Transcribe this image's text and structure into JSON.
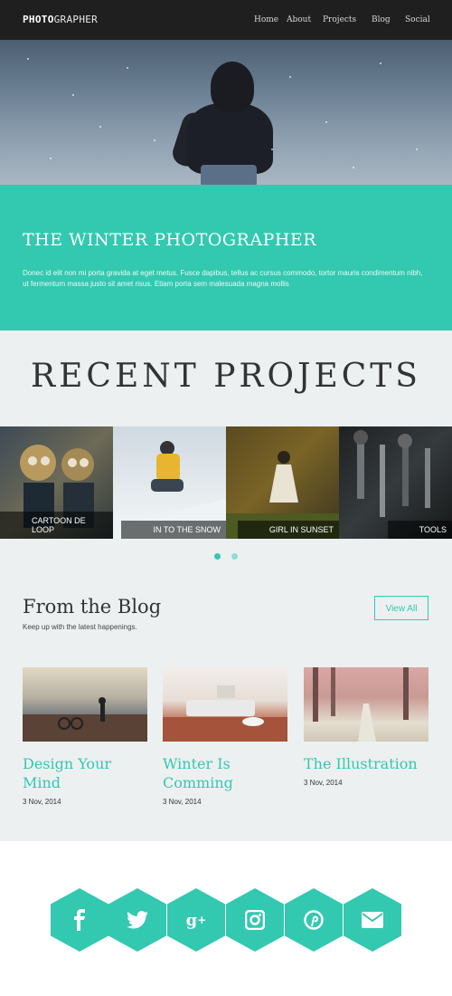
{
  "nav": {
    "logo_bold": "PHOTO",
    "logo_rest": "GRAPHER",
    "items": [
      "Home",
      "About",
      "Projects",
      "Blog",
      "Social"
    ]
  },
  "banner": {
    "title": "THE WINTER PHOTOGRAPHER",
    "text": "Donec id elit non mi porta gravida at eget metus. Fusce dapibus, tellus ac cursus commodo, tortor mauris condimentum nibh, ut fermentum massa justo sit amet risus. Etiam porta sem malesuada magna mollis"
  },
  "projects": {
    "title": "RECENT  PROJECTS",
    "tiles": [
      {
        "caption": "CARTOON DE LOOP"
      },
      {
        "caption": "IN TO THE SNOW"
      },
      {
        "caption": "GIRL IN SUNSET"
      },
      {
        "caption": "TOOLS"
      }
    ]
  },
  "blog": {
    "title": "From the Blog",
    "subtitle": "Keep up with the latest happenings.",
    "view_all": "View All",
    "posts": [
      {
        "title": "Design Your Mind",
        "date": "3 Nov, 2014"
      },
      {
        "title": "Winter Is Comming",
        "date": "3 Nov, 2014"
      },
      {
        "title": "The Illustration",
        "date": "3 Nov, 2014"
      }
    ]
  },
  "social": {
    "icons": [
      "facebook-icon",
      "twitter-icon",
      "google-plus-icon",
      "instagram-icon",
      "pinterest-icon",
      "mail-icon"
    ]
  },
  "colors": {
    "accent": "#33c8b0",
    "nav_bg": "#1f1f1f",
    "section_bg": "#ecf0f1"
  }
}
